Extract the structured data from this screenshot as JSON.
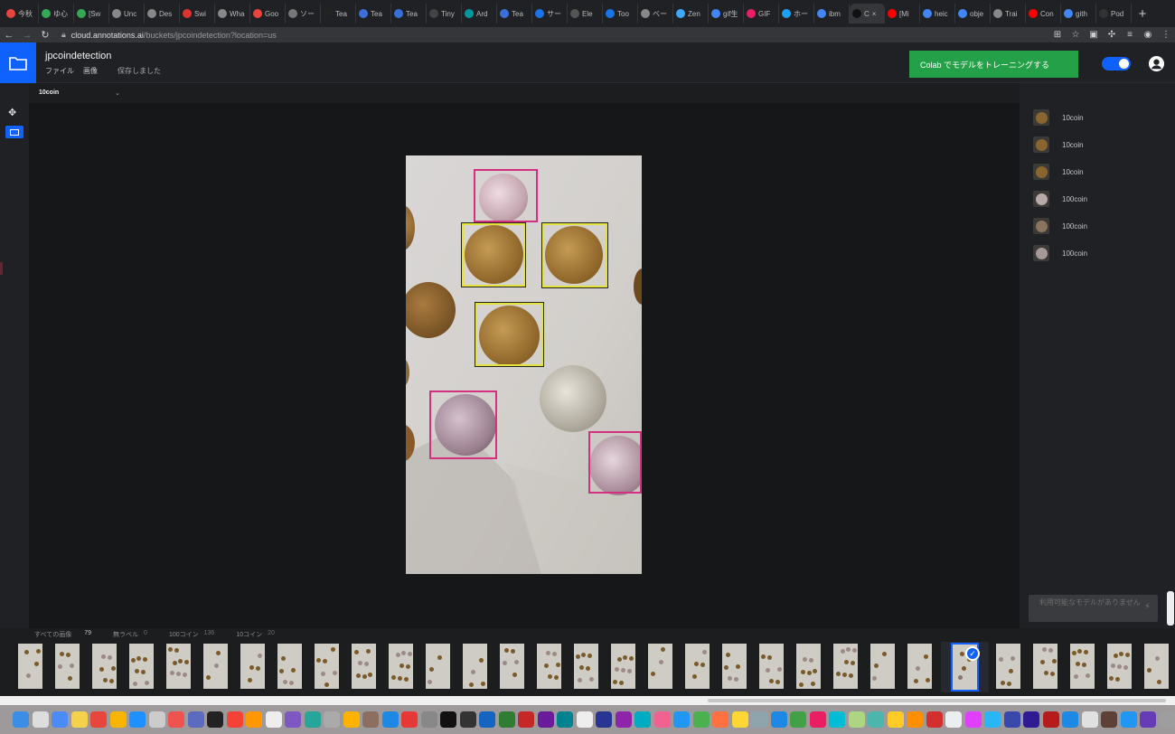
{
  "browser": {
    "tabs": [
      {
        "label": "今秋",
        "color": "#e8453c"
      },
      {
        "label": "ゆ心",
        "color": "#34a853"
      },
      {
        "label": "[Sw",
        "color": "#34a853"
      },
      {
        "label": "Unc",
        "color": "#888"
      },
      {
        "label": "Des",
        "color": "#888"
      },
      {
        "label": "Swi",
        "color": "#d33"
      },
      {
        "label": "Wha",
        "color": "#888"
      },
      {
        "label": "Goo",
        "color": "#e8453c"
      },
      {
        "label": "ソー",
        "color": "#777"
      },
      {
        "label": "Tea",
        "color": "#222"
      },
      {
        "label": "Tea",
        "color": "#3a6fd8"
      },
      {
        "label": "Tea",
        "color": "#3a6fd8"
      },
      {
        "label": "Tiny",
        "color": "#444"
      },
      {
        "label": "Ard",
        "color": "#00979c"
      },
      {
        "label": "Tea",
        "color": "#3a6fd8"
      },
      {
        "label": "サー",
        "color": "#1a73e8"
      },
      {
        "label": "Ele",
        "color": "#555"
      },
      {
        "label": "Too",
        "color": "#1a73e8"
      },
      {
        "label": "ベー",
        "color": "#888"
      },
      {
        "label": "Zen",
        "color": "#3ea8ff"
      },
      {
        "label": "gif生",
        "color": "#4285f4"
      },
      {
        "label": "GIF",
        "color": "#e91e63"
      },
      {
        "label": "ホー",
        "color": "#1da1f2"
      },
      {
        "label": "ibm",
        "color": "#4285f4"
      },
      {
        "label": "C",
        "color": "#111",
        "active": true
      },
      {
        "label": "[Mi",
        "color": "#f00"
      },
      {
        "label": "heic",
        "color": "#4285f4"
      },
      {
        "label": "obje",
        "color": "#4285f4"
      },
      {
        "label": "Trai",
        "color": "#888"
      },
      {
        "label": "Con",
        "color": "#f00"
      },
      {
        "label": "gith",
        "color": "#4285f4"
      },
      {
        "label": "Pod",
        "color": "#333"
      }
    ],
    "url_host": "cloud.annotations.ai",
    "url_path": "/buckets/jpcoindetection?location=us"
  },
  "app": {
    "project_title": "jpcoindetection",
    "menu_file": "ファイル",
    "menu_image": "画像",
    "save_status": "保存しました",
    "train_button": "Colab でモデルをトレーニングする",
    "toggle_on": true,
    "current_label": "10coin"
  },
  "annotations": [
    {
      "label": "10coin",
      "coin": "10"
    },
    {
      "label": "10coin",
      "coin": "10"
    },
    {
      "label": "10coin",
      "coin": "10"
    },
    {
      "label": "100coin",
      "coin": "100"
    },
    {
      "label": "100coin",
      "coin": "100"
    },
    {
      "label": "100coin",
      "coin": "100"
    }
  ],
  "model_placeholder": "利用可能なモデルがありません",
  "filmstrip": {
    "all_images_label": "すべての画像",
    "all_images_count": "79",
    "unlabeled_label": "無ラベル",
    "unlabeled_count": "0",
    "coin100_label": "100コイン",
    "coin100_count": "136",
    "coin10_label": "10コイン",
    "coin10_count": "20"
  },
  "colors": {
    "accent_blue": "#0f62fe",
    "train_green": "#24a148",
    "box_10coin": "#e6e23c",
    "box_100coin": "#d4307f"
  }
}
